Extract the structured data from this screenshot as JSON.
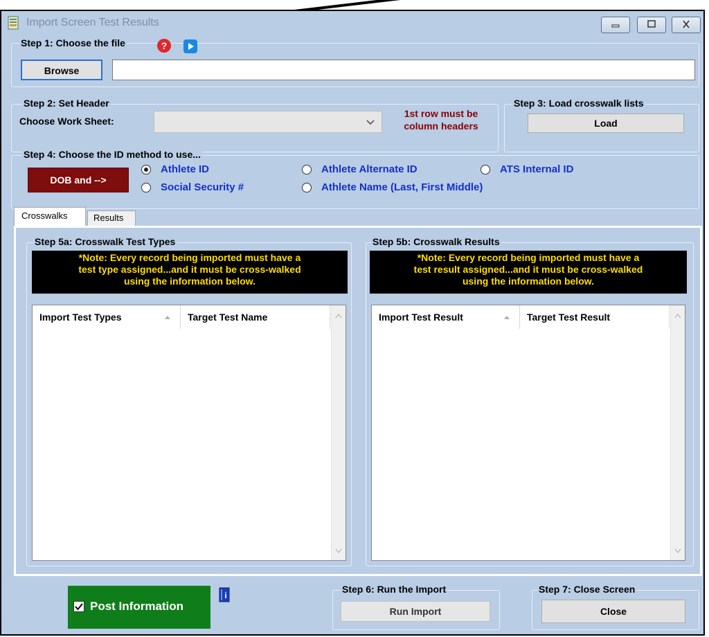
{
  "window": {
    "title": "Import Screen Test Results"
  },
  "step1": {
    "legend": "Step 1: Choose the file",
    "browse_label": "Browse",
    "file_value": ""
  },
  "step2": {
    "legend": "Step 2:  Set Header",
    "worksheet_label": "Choose Work Sheet:",
    "worksheet_value": "",
    "hint_line1": "1st row must be",
    "hint_line2": "column headers",
    "hint_color": "#8b0000"
  },
  "step3": {
    "legend": "Step 3:  Load crosswalk lists",
    "load_label": "Load"
  },
  "step4": {
    "legend": "Step 4:  Choose the ID method to use...",
    "dob_label": "DOB and -->",
    "options": [
      {
        "label": "Athlete ID",
        "checked": true
      },
      {
        "label": "Athlete Alternate ID",
        "checked": false
      },
      {
        "label": "ATS Internal ID",
        "checked": false
      },
      {
        "label": "Social Security #",
        "checked": false
      },
      {
        "label": "Athlete Name (Last, First Middle)",
        "checked": false
      }
    ]
  },
  "tabs": [
    {
      "label": "Crosswalks",
      "active": true
    },
    {
      "label": "Results",
      "active": false
    }
  ],
  "step5a": {
    "legend": "Step 5a: Crosswalk Test Types",
    "note_line1": "*Note:  Every record being imported must have a",
    "note_line2": "test type assigned...and it must be cross-walked",
    "note_line3": "using the information below.",
    "col1": "Import Test Types",
    "col2": "Target Test Name"
  },
  "step5b": {
    "legend": "Step 5b: Crosswalk Results",
    "note_line1": "*Note:  Every record being imported must have a",
    "note_line2": "test result assigned...and it must be cross-walked",
    "note_line3": "using the information below.",
    "col1": "Import Test Result",
    "col2": "Target Test Result"
  },
  "post": {
    "label": "Post Information",
    "checked": true,
    "bg_color": "#0f7d1a"
  },
  "step6": {
    "legend": "Step 6:  Run the Import",
    "run_label": "Run Import"
  },
  "step7": {
    "legend": "Step 7: Close Screen",
    "close_label": "Close"
  },
  "colors": {
    "window_bg": "#b9cde5",
    "radio_text": "#1530c8",
    "dob_bg": "#7e0d0d",
    "note_bg": "#000000",
    "note_text": "#ffde00"
  }
}
